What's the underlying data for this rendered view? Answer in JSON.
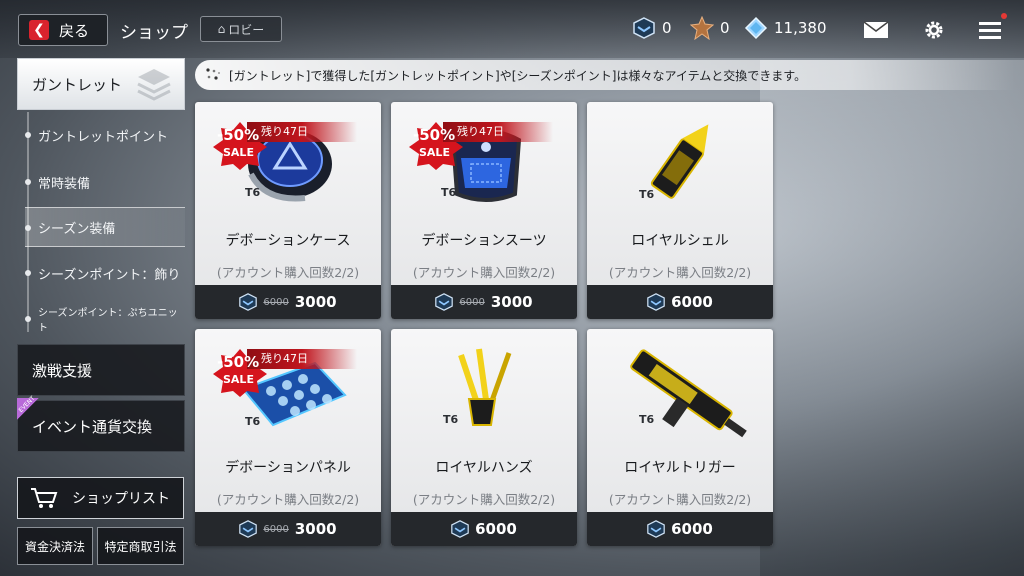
{
  "header": {
    "back_label": "戻る",
    "title": "ショップ",
    "lobby_label": "ロビー",
    "currencies": [
      {
        "icon": "cube-token-icon",
        "value": "0"
      },
      {
        "icon": "bronze-medal-icon",
        "value": "0"
      },
      {
        "icon": "diamond-icon",
        "value": "11,380"
      }
    ]
  },
  "sidebar": {
    "main_tab": "ガントレット",
    "sub_items": [
      {
        "label": "ガントレットポイント"
      },
      {
        "label": "常時装備"
      },
      {
        "label": "シーズン装備"
      },
      {
        "label": "シーズンポイント：飾り"
      },
      {
        "label": "シーズンポイント：ぷちユニット"
      }
    ],
    "tabs": [
      {
        "label": "激戦支援"
      },
      {
        "label": "イベント通貨交換",
        "badge": "EVENT"
      }
    ],
    "shoplist_label": "ショップリスト",
    "footer_buttons": [
      {
        "label": "資金決済法"
      },
      {
        "label": "特定商取引法"
      }
    ]
  },
  "info_banner": "[ガントレット]で獲得した[ガントレットポイント]や[シーズンポイント]は様々なアイテムと交換できます。",
  "products": [
    {
      "name": "デボーションケース",
      "limit": "(アカウント購入回数2/2)",
      "old_price": "6000",
      "price": "3000",
      "sale_percent": "-50%",
      "sale_label": "SALE",
      "days_left": "残り47日",
      "tier": "T6"
    },
    {
      "name": "デボーションスーツ",
      "limit": "(アカウント購入回数2/2)",
      "old_price": "6000",
      "price": "3000",
      "sale_percent": "-50%",
      "sale_label": "SALE",
      "days_left": "残り47日",
      "tier": "T6"
    },
    {
      "name": "ロイヤルシェル",
      "limit": "(アカウント購入回数2/2)",
      "old_price": "",
      "price": "6000",
      "tier": "T6"
    },
    {
      "name": "デボーションパネル",
      "limit": "(アカウント購入回数2/2)",
      "old_price": "6000",
      "price": "3000",
      "sale_percent": "-50%",
      "sale_label": "SALE",
      "days_left": "残り47日",
      "tier": "T6"
    },
    {
      "name": "ロイヤルハンズ",
      "limit": "(アカウント購入回数2/2)",
      "old_price": "",
      "price": "6000",
      "tier": "T6"
    },
    {
      "name": "ロイヤルトリガー",
      "limit": "(アカウント購入回数2/2)",
      "old_price": "",
      "price": "6000",
      "tier": "T6"
    }
  ],
  "colors": {
    "accent_red": "#d9232d",
    "sale_red": "#c0161e",
    "card_bg": "#f2f3f4",
    "price_bar": "#25282c"
  }
}
